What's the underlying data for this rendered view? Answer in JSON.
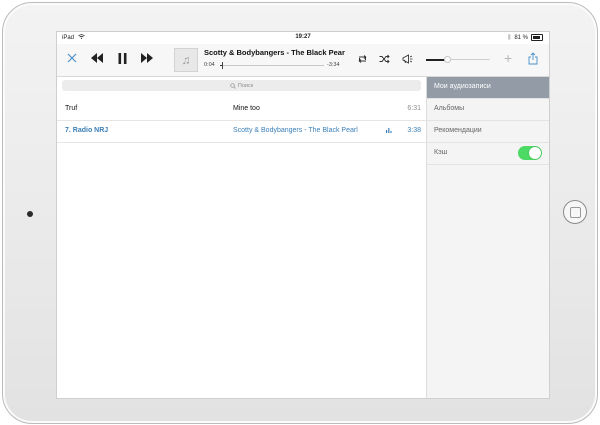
{
  "status": {
    "device": "iPad",
    "time": "19:27",
    "battery": "81 %"
  },
  "player": {
    "title": "Scotty & Bodybangers - The Black Pear",
    "elapsed": "0:04",
    "remaining": "-3:34",
    "progress": 0.02,
    "volume": 0.33
  },
  "search": {
    "placeholder": "Поиск"
  },
  "tracks": [
    {
      "artist": "Truf",
      "title": "Mine too",
      "duration": "6:31",
      "playing": false
    },
    {
      "artist": "7. Radio NRJ",
      "title": "Scotty & Bodybangers - The Black Pearl",
      "duration": "3:38",
      "playing": true
    }
  ],
  "sidebar": {
    "items": [
      {
        "label": "Мои аудиозаписи",
        "selected": true
      },
      {
        "label": "Альбомы",
        "selected": false
      },
      {
        "label": "Рекомендации",
        "selected": false
      },
      {
        "label": "Кэш",
        "selected": false,
        "toggle": true
      }
    ]
  },
  "colors": {
    "accent": "#3b7fb8",
    "toggle_on": "#4cd964",
    "sidebar_selected": "#929ba6"
  },
  "icons": [
    "close-icon",
    "rewind-icon",
    "pause-icon",
    "fast-forward-icon",
    "music-note-icon",
    "repeat-icon",
    "shuffle-icon",
    "broadcast-icon",
    "plus-icon",
    "share-icon",
    "search-icon",
    "equalizer-icon",
    "wifi-icon"
  ]
}
